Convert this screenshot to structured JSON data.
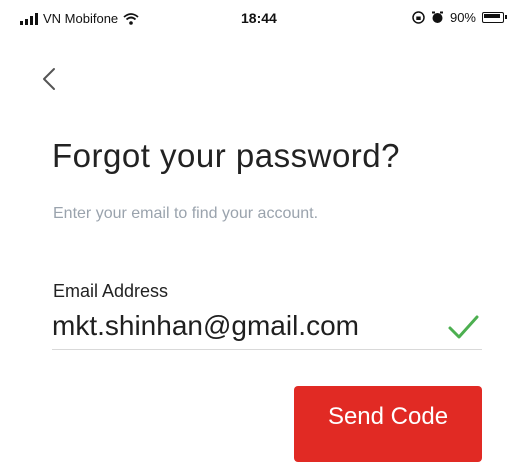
{
  "status_bar": {
    "carrier": "VN Mobifone",
    "time": "18:44",
    "battery": "90%"
  },
  "header": {
    "title": "Forgot your password?",
    "subtitle": "Enter your email to find your account."
  },
  "form": {
    "email_label": "Email Address",
    "email_value": "mkt.shinhan@gmail.com"
  },
  "actions": {
    "send_label": "Send Code"
  },
  "colors": {
    "primary": "#e12a24",
    "valid": "#4caf50",
    "muted": "#9aa3ad"
  },
  "icons": {
    "back": "chevron-left-icon",
    "valid": "checkmark-icon",
    "wifi": "wifi-icon",
    "alarm": "alarm-icon",
    "lock": "rotation-lock-icon"
  }
}
